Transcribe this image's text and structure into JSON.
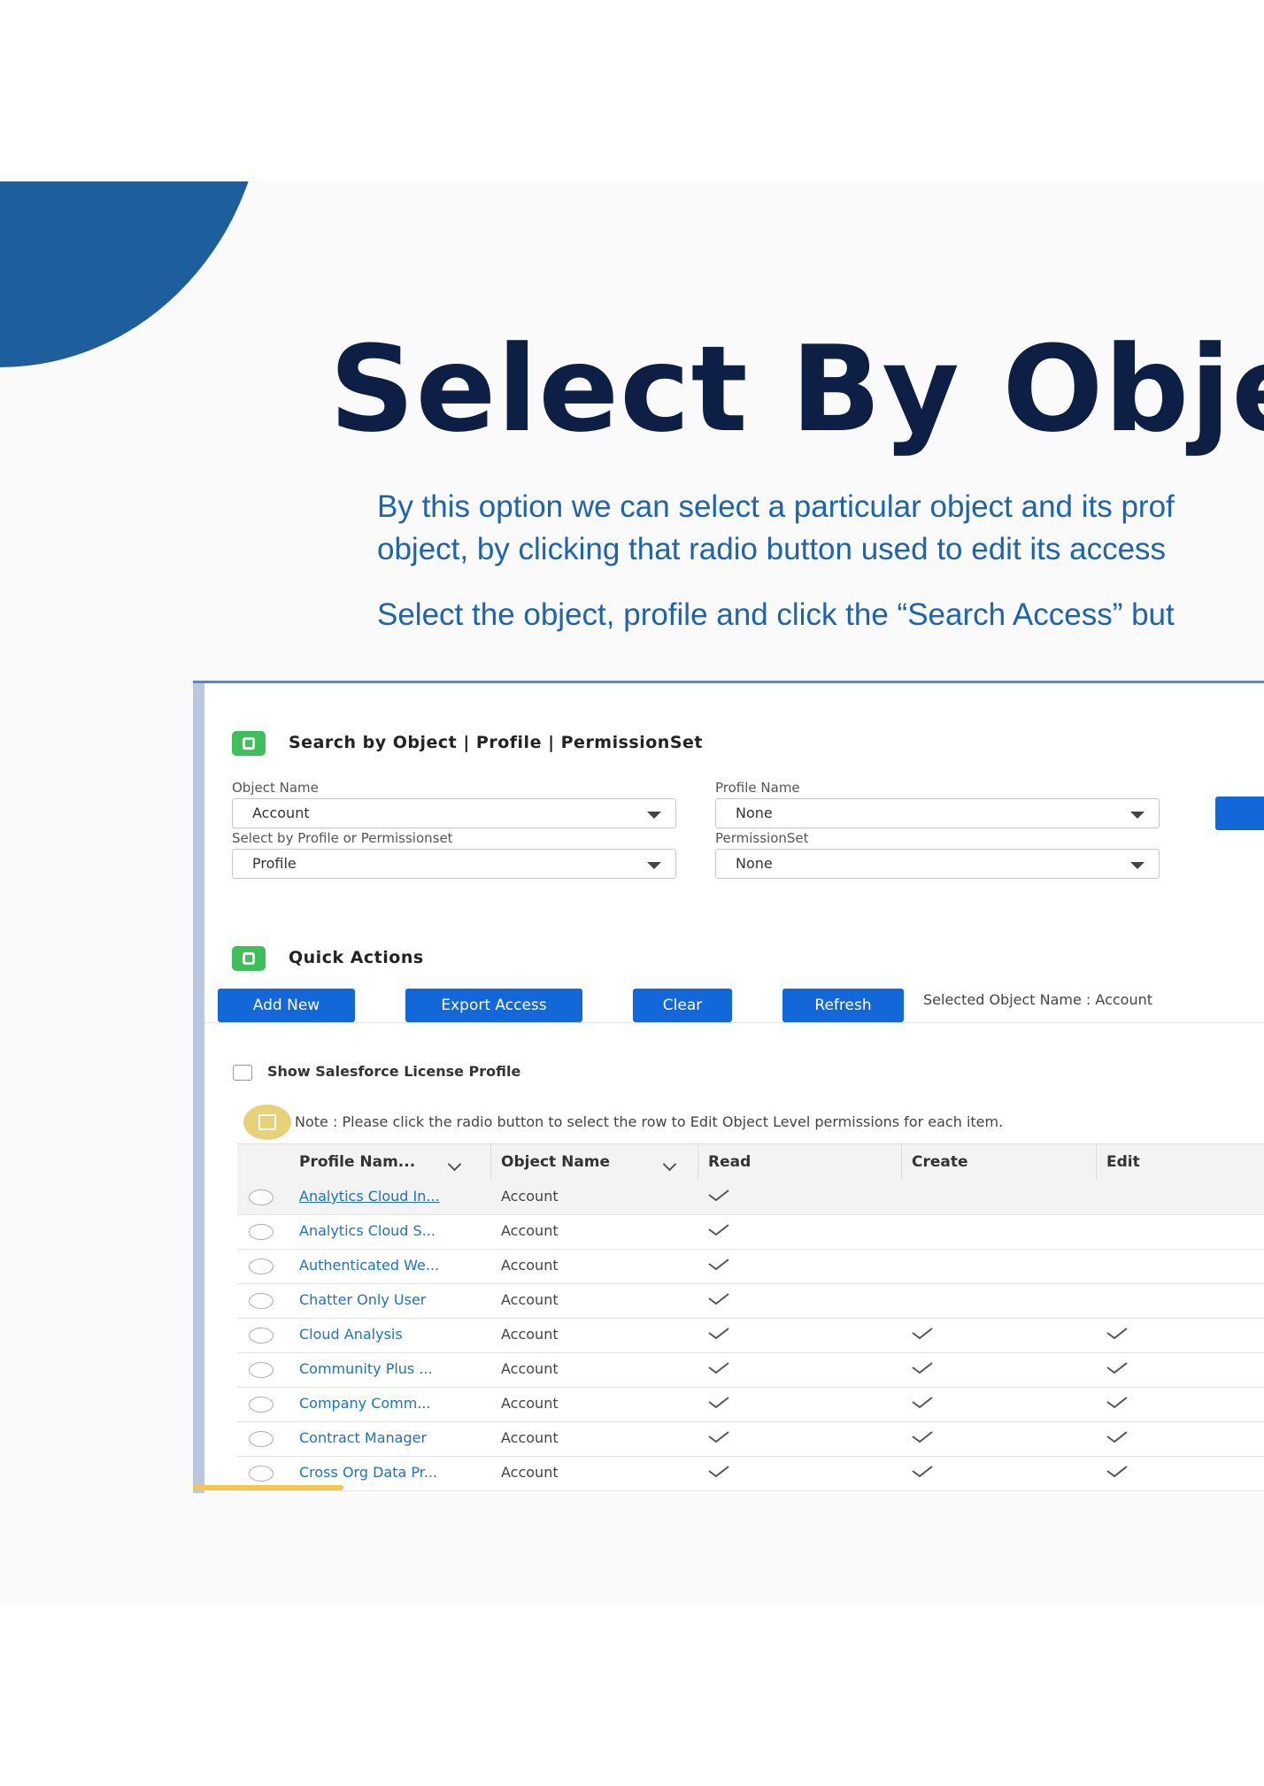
{
  "slide": {
    "title": "Select By Object",
    "description_lines": [
      "By this option we can select a particular object and its prof",
      "object, by clicking that radio button used to edit its access",
      "Select the object, profile and click the “Search Access” but"
    ]
  },
  "search": {
    "title": "Search by Object | Profile | PermissionSet",
    "object_name_label": "Object Name",
    "object_name_value": "Account",
    "profile_name_label": "Profile Name",
    "profile_name_value": "None",
    "select_by_label": "Select by Profile or Permissionset",
    "select_by_value": "Profile",
    "permissionset_label": "PermissionSet",
    "permissionset_value": "None"
  },
  "quick_actions": {
    "title": "Quick Actions",
    "add_new": "Add New",
    "export_access": "Export Access",
    "clear": "Clear",
    "refresh": "Refresh",
    "selected_object": "Selected Object Name : Account"
  },
  "options": {
    "show_license_label": "Show Salesforce License Profile",
    "show_license_checked": false
  },
  "note": "Note : Please click the radio button to select the row to Edit Object Level permissions for each item.",
  "table": {
    "columns": [
      "Profile Nam...",
      "Object Name",
      "Read",
      "Create",
      "Edit"
    ],
    "rows": [
      {
        "profile": "Analytics Cloud In...",
        "object": "Account",
        "read": true,
        "create": false,
        "edit": false
      },
      {
        "profile": "Analytics Cloud S...",
        "object": "Account",
        "read": true,
        "create": false,
        "edit": false
      },
      {
        "profile": "Authenticated We...",
        "object": "Account",
        "read": true,
        "create": false,
        "edit": false
      },
      {
        "profile": "Chatter Only User",
        "object": "Account",
        "read": true,
        "create": false,
        "edit": false
      },
      {
        "profile": "Cloud Analysis",
        "object": "Account",
        "read": true,
        "create": true,
        "edit": true
      },
      {
        "profile": "Community Plus ...",
        "object": "Account",
        "read": true,
        "create": true,
        "edit": true
      },
      {
        "profile": "Company Comm...",
        "object": "Account",
        "read": true,
        "create": true,
        "edit": true
      },
      {
        "profile": "Contract Manager",
        "object": "Account",
        "read": true,
        "create": true,
        "edit": true
      },
      {
        "profile": "Cross Org Data Pr...",
        "object": "Account",
        "read": true,
        "create": true,
        "edit": true
      }
    ]
  },
  "colors": {
    "title": "#0d1f45",
    "description": "#1b64b2",
    "accent_arc": "#1d5f9c",
    "button": "#1268d9",
    "section_icon": "#3fbf5a",
    "link": "#1a73c8"
  }
}
